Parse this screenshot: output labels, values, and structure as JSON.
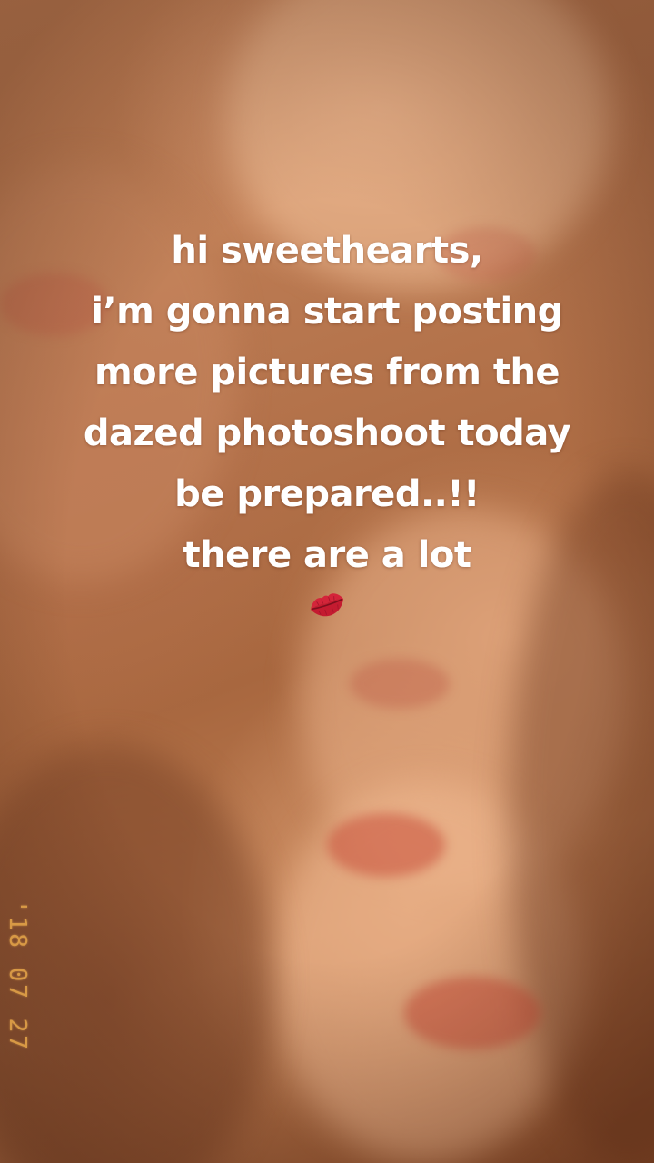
{
  "story": {
    "caption_lines": [
      "hi sweethearts,",
      "i’m gonna start posting",
      "more pictures from the",
      "dazed photoshoot today",
      "be prepared..!!",
      "there are a lot"
    ],
    "emoji_icon": "kiss-mark-icon",
    "date_stamp": "'18 07 27"
  },
  "colors": {
    "caption_text": "#ffffff",
    "date_stamp": "#e8a84a",
    "lips": "#c84e3a"
  }
}
